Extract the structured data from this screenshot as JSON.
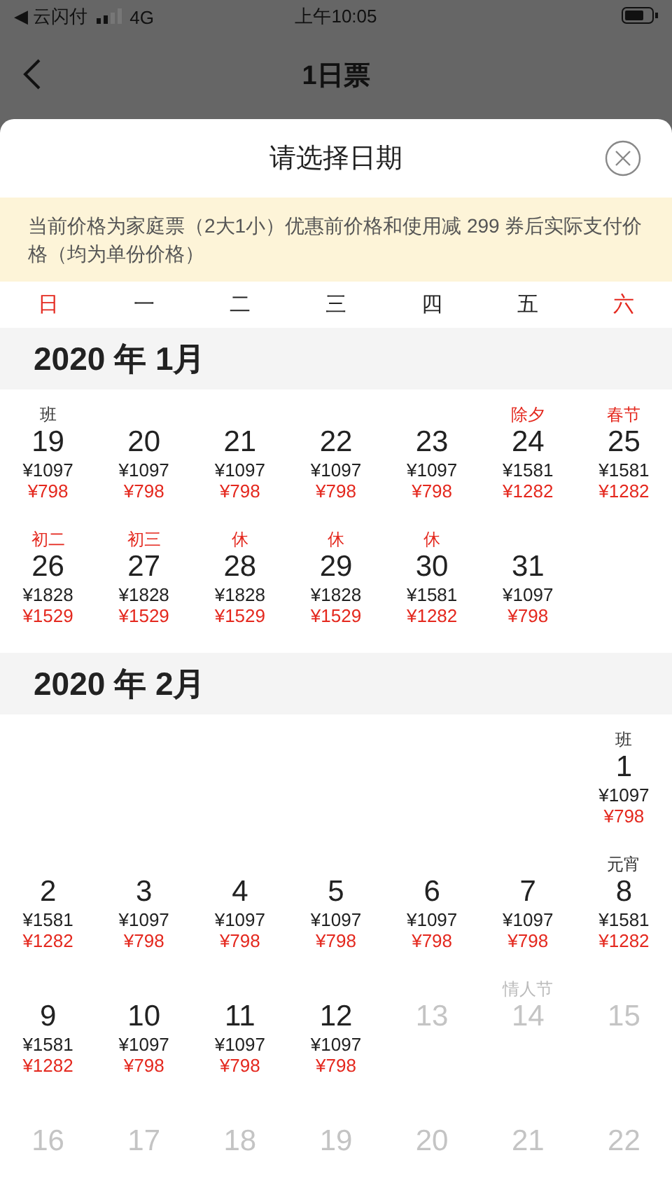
{
  "status_bar": {
    "back_app": "◀ 云闪付",
    "network": "4G",
    "time": "上午10:05"
  },
  "nav": {
    "title": "1日票"
  },
  "sheet": {
    "title": "请选择日期",
    "notice": "当前价格为家庭票（2大1小）优惠前价格和使用减 299 券后实际支付价格（均为单份价格）",
    "weekdays": [
      {
        "label": "日",
        "weekend": true
      },
      {
        "label": "一",
        "weekend": false
      },
      {
        "label": "二",
        "weekend": false
      },
      {
        "label": "三",
        "weekend": false
      },
      {
        "label": "四",
        "weekend": false
      },
      {
        "label": "五",
        "weekend": false
      },
      {
        "label": "六",
        "weekend": true
      }
    ],
    "months": [
      {
        "title": "2020 年 1月",
        "weeks": [
          [
            {
              "kind": "day",
              "day": "19",
              "tag": "班",
              "holiday": false,
              "price": "¥1097",
              "discount": "¥798"
            },
            {
              "kind": "day",
              "day": "20",
              "price": "¥1097",
              "discount": "¥798"
            },
            {
              "kind": "day",
              "day": "21",
              "price": "¥1097",
              "discount": "¥798"
            },
            {
              "kind": "day",
              "day": "22",
              "price": "¥1097",
              "discount": "¥798"
            },
            {
              "kind": "day",
              "day": "23",
              "price": "¥1097",
              "discount": "¥798"
            },
            {
              "kind": "day",
              "day": "24",
              "tag": "除夕",
              "holiday": true,
              "price": "¥1581",
              "discount": "¥1282"
            },
            {
              "kind": "day",
              "day": "25",
              "tag": "春节",
              "holiday": true,
              "price": "¥1581",
              "discount": "¥1282"
            }
          ],
          [
            {
              "kind": "day",
              "day": "26",
              "tag": "初二",
              "holiday": true,
              "price": "¥1828",
              "discount": "¥1529"
            },
            {
              "kind": "day",
              "day": "27",
              "tag": "初三",
              "holiday": true,
              "price": "¥1828",
              "discount": "¥1529"
            },
            {
              "kind": "day",
              "day": "28",
              "tag": "休",
              "holiday": true,
              "price": "¥1828",
              "discount": "¥1529"
            },
            {
              "kind": "day",
              "day": "29",
              "tag": "休",
              "holiday": true,
              "price": "¥1828",
              "discount": "¥1529"
            },
            {
              "kind": "day",
              "day": "30",
              "tag": "休",
              "holiday": true,
              "price": "¥1581",
              "discount": "¥1282"
            },
            {
              "kind": "day",
              "day": "31",
              "price": "¥1097",
              "discount": "¥798"
            },
            {
              "kind": "blank"
            }
          ]
        ]
      },
      {
        "title": "2020 年 2月",
        "weeks": [
          [
            {
              "kind": "blank"
            },
            {
              "kind": "blank"
            },
            {
              "kind": "blank"
            },
            {
              "kind": "blank"
            },
            {
              "kind": "blank"
            },
            {
              "kind": "blank"
            },
            {
              "kind": "day",
              "day": "1",
              "tag": "班",
              "holiday": false,
              "price": "¥1097",
              "discount": "¥798"
            }
          ],
          [
            {
              "kind": "day",
              "day": "2",
              "price": "¥1581",
              "discount": "¥1282"
            },
            {
              "kind": "day",
              "day": "3",
              "price": "¥1097",
              "discount": "¥798"
            },
            {
              "kind": "day",
              "day": "4",
              "price": "¥1097",
              "discount": "¥798"
            },
            {
              "kind": "day",
              "day": "5",
              "price": "¥1097",
              "discount": "¥798"
            },
            {
              "kind": "day",
              "day": "6",
              "price": "¥1097",
              "discount": "¥798"
            },
            {
              "kind": "day",
              "day": "7",
              "price": "¥1097",
              "discount": "¥798"
            },
            {
              "kind": "day",
              "day": "8",
              "tag": "元宵",
              "holiday": false,
              "price": "¥1581",
              "discount": "¥1282"
            }
          ],
          [
            {
              "kind": "day",
              "day": "9",
              "price": "¥1581",
              "discount": "¥1282"
            },
            {
              "kind": "day",
              "day": "10",
              "price": "¥1097",
              "discount": "¥798"
            },
            {
              "kind": "day",
              "day": "11",
              "price": "¥1097",
              "discount": "¥798"
            },
            {
              "kind": "day",
              "day": "12",
              "price": "¥1097",
              "discount": "¥798"
            },
            {
              "kind": "unavailable",
              "day": "13"
            },
            {
              "kind": "unavailable",
              "day": "14",
              "tag": "情人节"
            },
            {
              "kind": "unavailable",
              "day": "15"
            }
          ],
          [
            {
              "kind": "unavailable",
              "day": "16"
            },
            {
              "kind": "unavailable",
              "day": "17"
            },
            {
              "kind": "unavailable",
              "day": "18"
            },
            {
              "kind": "unavailable",
              "day": "19"
            },
            {
              "kind": "unavailable",
              "day": "20"
            },
            {
              "kind": "unavailable",
              "day": "21"
            },
            {
              "kind": "unavailable",
              "day": "22"
            }
          ]
        ]
      }
    ]
  }
}
